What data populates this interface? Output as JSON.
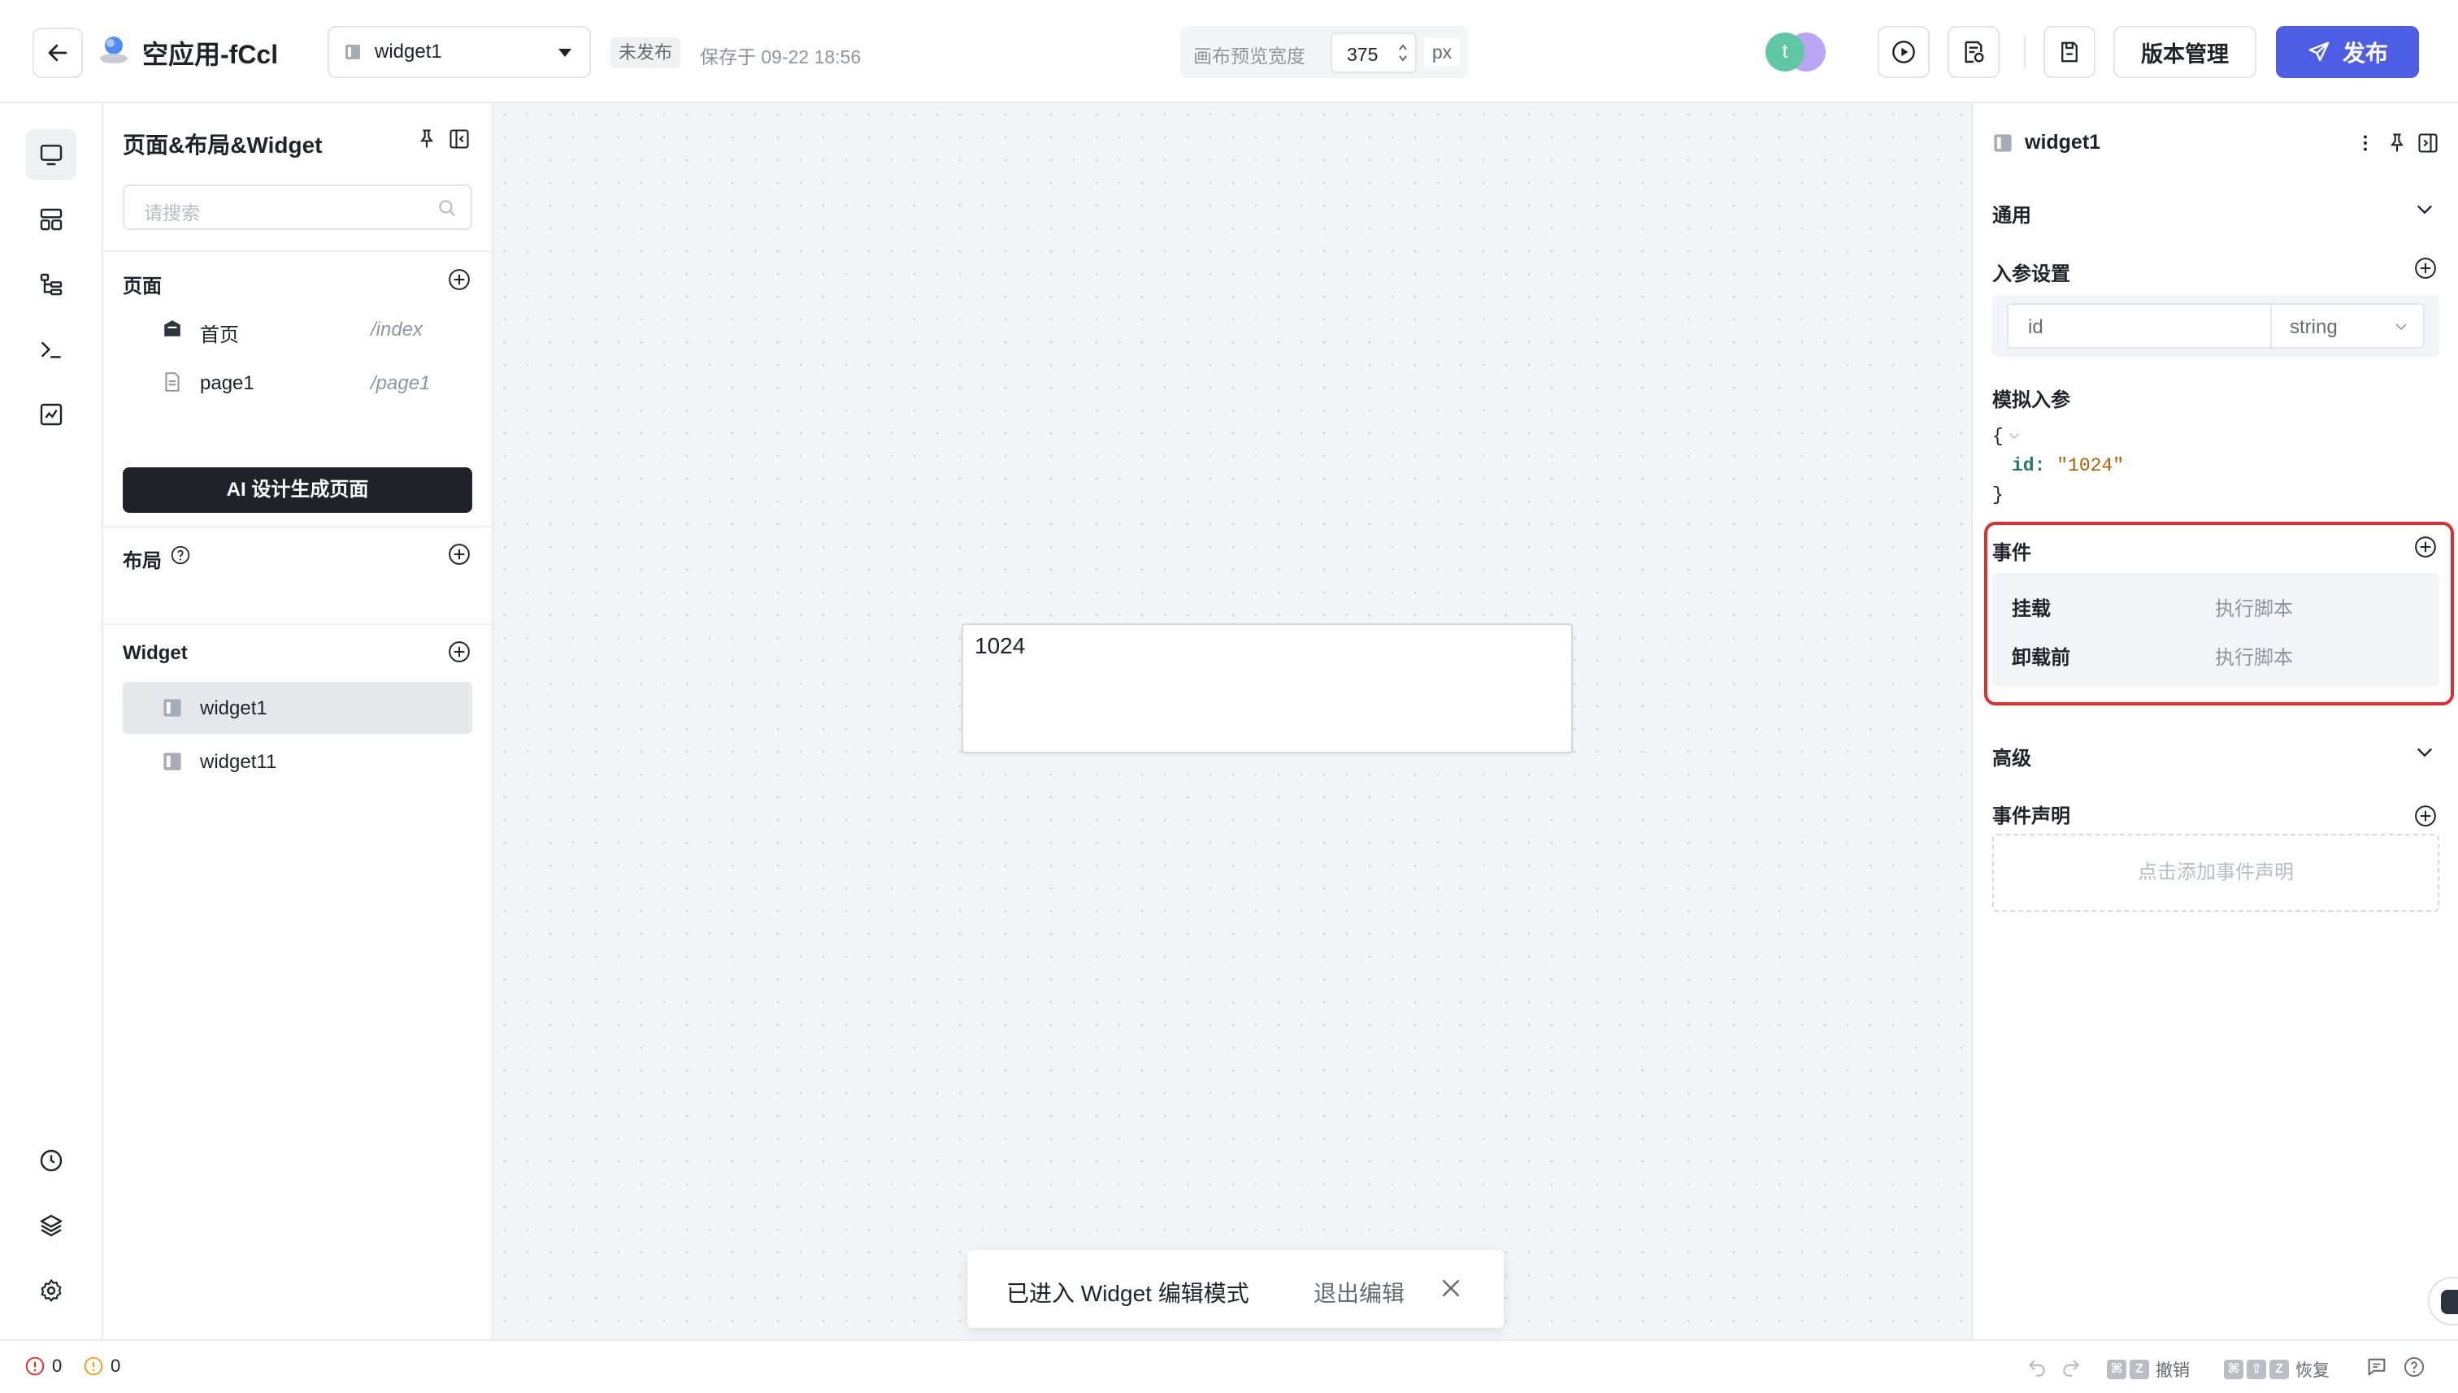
{
  "header": {
    "app_title": "空应用-fCcl",
    "widget_select": "widget1",
    "status_badge": "未发布",
    "saved_text": "保存于 09-22 18:56",
    "canvas_width_label": "画布预览宽度",
    "canvas_width_value": "375",
    "canvas_width_unit": "px",
    "avatar_letter": "t",
    "version_button": "版本管理",
    "publish_button": "发布",
    "accent_color": "#4e5ee4"
  },
  "left_panel": {
    "title": "页面&布局&Widget",
    "search_placeholder": "请搜索",
    "pages_section": "页面",
    "pages": [
      {
        "name": "首页",
        "path": "/index"
      },
      {
        "name": "page1",
        "path": "/page1"
      }
    ],
    "ai_button": "AI 设计生成页面",
    "layout_section": "布局",
    "widget_section": "Widget",
    "widgets": [
      {
        "name": "widget1",
        "selected": true
      },
      {
        "name": "widget11",
        "selected": false
      }
    ]
  },
  "canvas": {
    "widget_value": "1024",
    "toast_text": "已进入 Widget 编辑模式",
    "toast_exit": "退出编辑"
  },
  "right_panel": {
    "title": "widget1",
    "general_section": "通用",
    "params_section": "入参设置",
    "param_name": "id",
    "param_type": "string",
    "mock_section": "模拟入参",
    "mock_open": "{",
    "mock_key": "id:",
    "mock_value": "\"1024\"",
    "mock_close": "}",
    "events_section": "事件",
    "events": [
      {
        "name": "挂载",
        "action": "执行脚本"
      },
      {
        "name": "卸载前",
        "action": "执行脚本"
      }
    ],
    "advanced_section": "高级",
    "event_decl_section": "事件声明",
    "event_decl_placeholder": "点击添加事件声明"
  },
  "bottom_bar": {
    "error_count": "0",
    "warning_count": "0",
    "undo_label": "撤销",
    "redo_label": "恢复",
    "key_cmd": "⌘",
    "key_z": "Z",
    "key_shift": "⇧"
  }
}
